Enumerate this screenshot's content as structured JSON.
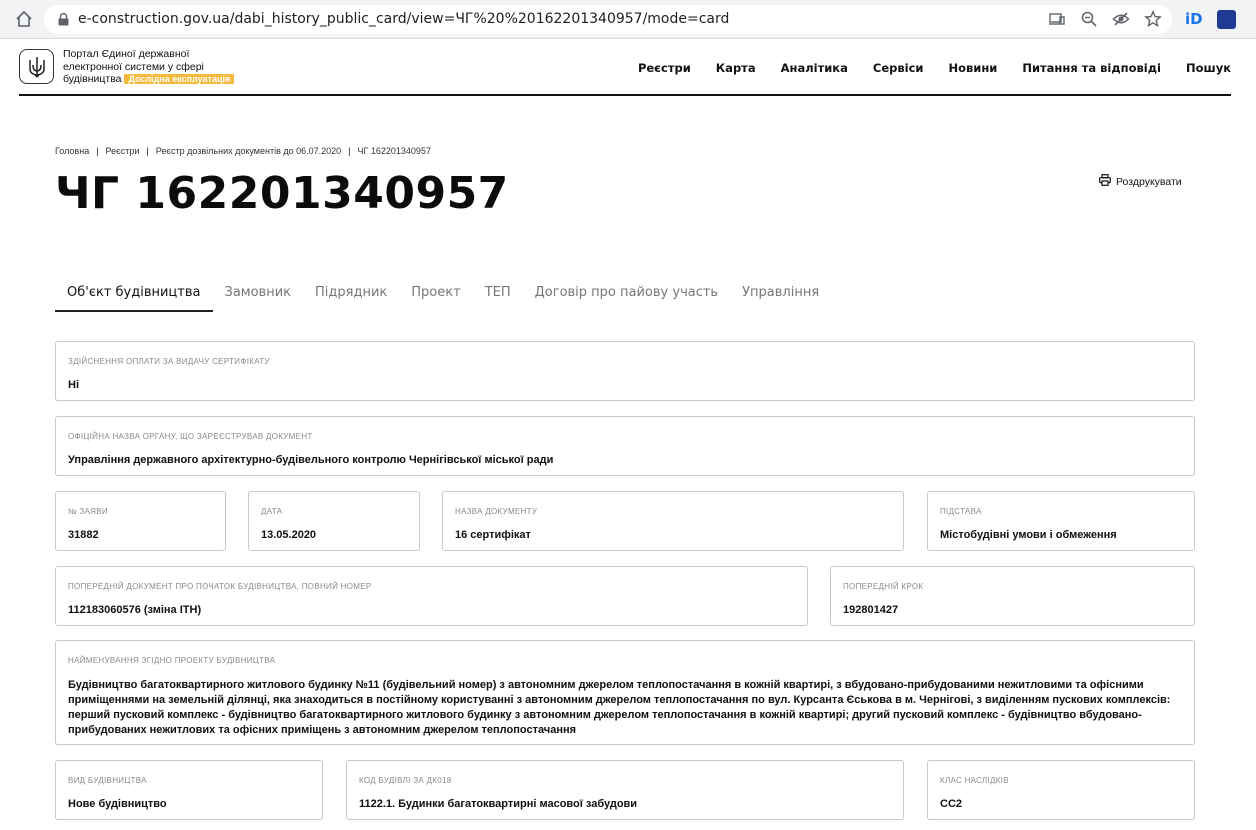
{
  "browser": {
    "url": "e-construction.gov.ua/dabi_history_public_card/view=ЧГ%20%20162201340957/mode=card"
  },
  "site": {
    "logo_line1": "Портал Єдиної державної",
    "logo_line2": "електронної системи у сфері",
    "logo_line3": "будівництва",
    "beta_badge": "Дослідна експлуатація",
    "nav": [
      "Реєстри",
      "Карта",
      "Аналітика",
      "Сервіси",
      "Новини",
      "Питання та відповіді",
      "Пошук"
    ]
  },
  "breadcrumb": [
    "Головна",
    "Реєстри",
    "Реєстр дозвільних документів до 06.07.2020",
    "ЧГ 162201340957"
  ],
  "page_title": "ЧГ 162201340957",
  "print_label": "Роздрукувати",
  "tabs": [
    "Об'єкт будівництва",
    "Замовник",
    "Підрядник",
    "Проект",
    "ТЕП",
    "Договір про пайову участь",
    "Управління"
  ],
  "fields": {
    "payment": {
      "label": "Здійснення оплати за видачу сертифікату",
      "value": "Ні"
    },
    "authority": {
      "label": "Офіційна назва органу, що зареєстрував документ",
      "value": "Управління державного архітектурно-будівельного контролю Чернігівської міської ради"
    },
    "application_no": {
      "label": "№ заяви",
      "value": "31882"
    },
    "date": {
      "label": "Дата",
      "value": "13.05.2020"
    },
    "doc_name": {
      "label": "Назва документу",
      "value": "16 сертифікат"
    },
    "basis": {
      "label": "Підстава",
      "value": "Містобудівні умови і обмеження"
    },
    "prev_doc": {
      "label": "Попередній документ про початок будівництва, повний номер",
      "value": "112183060576 (зміна ІТН)"
    },
    "prev_step": {
      "label": "Попередній крок",
      "value": "192801427"
    },
    "project_name": {
      "label": "Найменування згідно проекту будівництва",
      "value": "Будівництво багатоквартирного житлового будинку №11 (будівельний номер) з автономним джерелом теплопостачання в кожній квартирі, з вбудовано-прибудованими нежитловими та офісними приміщеннями на земельній ділянці, яка знаходиться в постійному користуванні з автономним джерелом теплопостачання по вул. Курсанта Єськова в м. Чернігові, з виділенням пускових комплексів: перший пусковий комплекс - будівництво багатоквартирного житлового будинку з автономним джерелом теплопостачання в кожній квартирі; другий пусковий комплекс - будівництво вбудовано-прибудованих нежитлових та офісних приміщень з автономним джерелом теплопостачання"
    },
    "construction_type": {
      "label": "Вид будівництва",
      "value": "Нове будівництво"
    },
    "building_code": {
      "label": "Код будівлі за ДК018",
      "value": "1122.1. Будинки багатоквартирні масової забудови"
    },
    "consequence_class": {
      "label": "Клас наслідків",
      "value": "СС2"
    }
  }
}
